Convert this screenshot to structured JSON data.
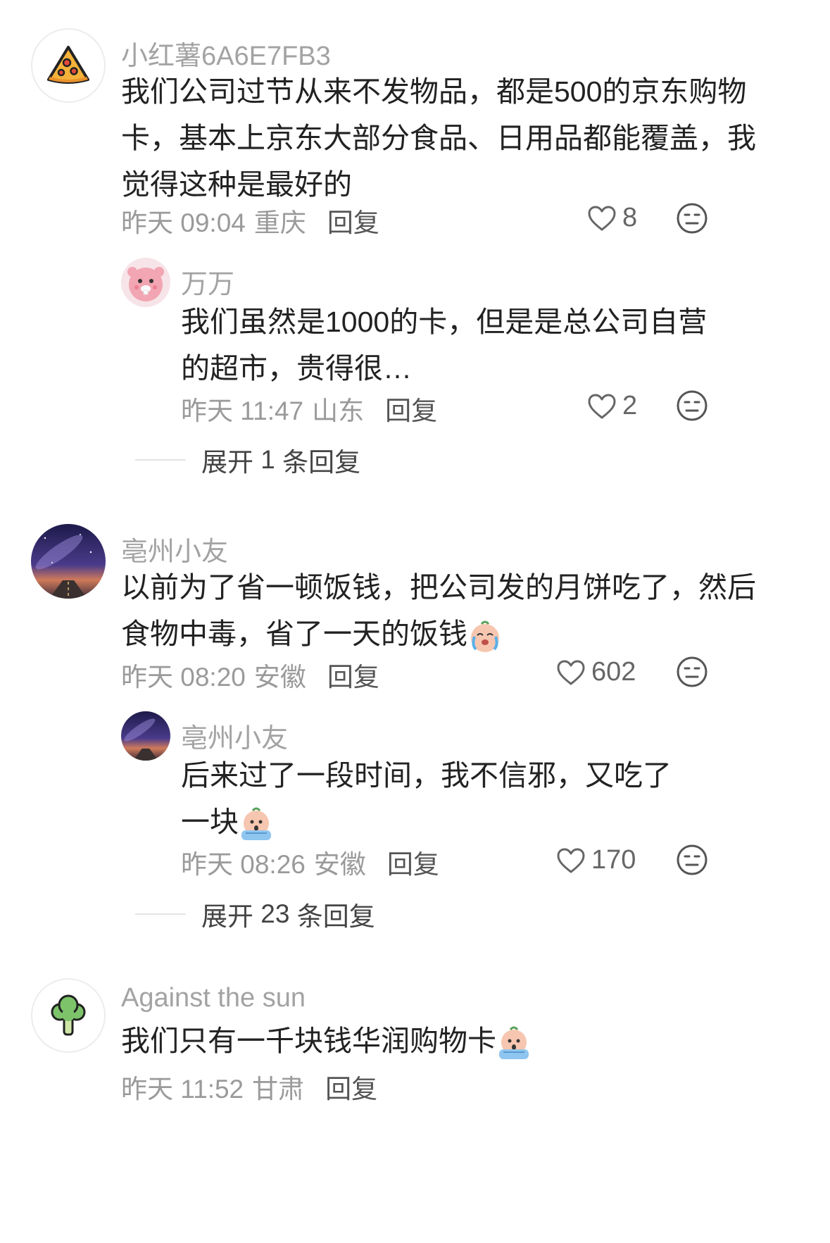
{
  "comments": [
    {
      "username": "小红薯6A6E7FB3",
      "text": "我们公司过节从来不发物品，都是500的京东购物卡，基本上京东大部分食品、日用品都能覆盖，我觉得这种是最好的",
      "time": "昨天 09:04",
      "location": "重庆",
      "reply_label": "回复",
      "likes": "8",
      "avatar_icon": "pizza-icon"
    },
    {
      "username": "万万",
      "text": "我们虽然是1000的卡，但是是总公司自营的超市，贵得很…",
      "time": "昨天 11:47",
      "location": "山东",
      "reply_label": "回复",
      "likes": "2",
      "avatar_icon": "pink-beaver-avatar"
    },
    {
      "username": "亳州小友",
      "text": "以前为了省一顿饭钱，把公司发的月饼吃了，然后食物中毒，省了一天的饭钱",
      "time": "昨天 08:20",
      "location": "安徽",
      "reply_label": "回复",
      "likes": "602",
      "avatar_icon": "galaxy-road-avatar"
    },
    {
      "username": "亳州小友",
      "text": "后来过了一段时间，我不信邪，又吃了一块",
      "time": "昨天 08:26",
      "location": "安徽",
      "reply_label": "回复",
      "likes": "170",
      "avatar_icon": "galaxy-road-avatar"
    },
    {
      "username": "Against the sun",
      "text": "我们只有一千块钱华润购物卡",
      "time": "昨天 11:52",
      "location": "甘肃",
      "reply_label": "回复",
      "avatar_icon": "broccoli-icon"
    }
  ],
  "expand": [
    {
      "prefix": "展开",
      "count": "1",
      "suffix": "条回复"
    },
    {
      "prefix": "展开",
      "count": "23",
      "suffix": "条回复"
    }
  ],
  "colors": {
    "username": "#a3a3a3",
    "text": "#222222",
    "meta": "#9a9a9a",
    "icon_stroke": "#666666"
  }
}
